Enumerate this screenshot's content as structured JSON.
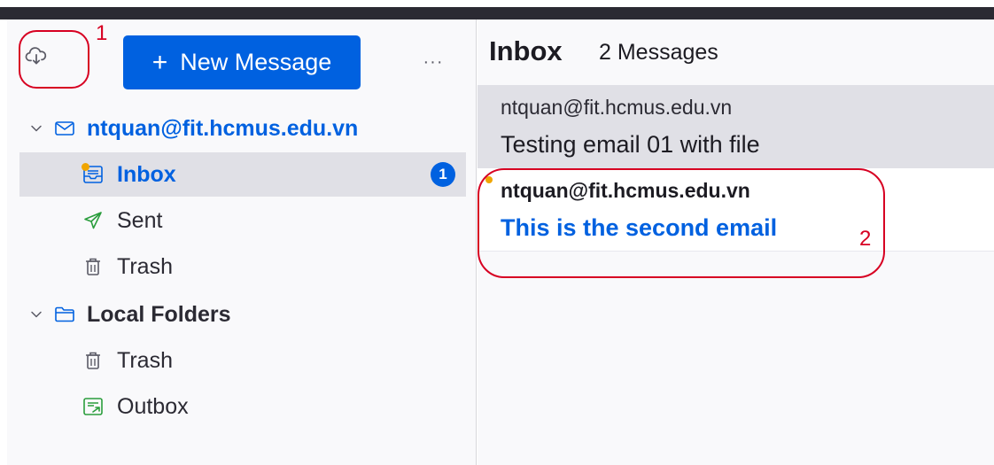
{
  "toolbar": {
    "get_messages_icon": "cloud-download-icon",
    "new_message_label": "New Message",
    "new_message_plus": "+",
    "more_label": "···"
  },
  "folders": {
    "account": {
      "label": "ntquan@fit.hcmus.edu.vn",
      "icon": "envelope-icon"
    },
    "inbox": {
      "label": "Inbox",
      "unread": "1",
      "icon": "inbox-icon"
    },
    "sent": {
      "label": "Sent",
      "icon": "paper-plane-icon"
    },
    "trash": {
      "label": "Trash",
      "icon": "trash-icon"
    },
    "local": {
      "label": "Local Folders",
      "icon": "folder-icon"
    },
    "local_trash": {
      "label": "Trash",
      "icon": "trash-icon"
    },
    "outbox": {
      "label": "Outbox",
      "icon": "outbox-icon"
    }
  },
  "message_list": {
    "title": "Inbox",
    "count": "2 Messages",
    "messages": [
      {
        "from": "ntquan@fit.hcmus.edu.vn",
        "subject": "Testing email 01 with file",
        "unread": false
      },
      {
        "from": "ntquan@fit.hcmus.edu.vn",
        "subject": "This is the second email",
        "unread": true
      }
    ]
  },
  "annotations": {
    "one": "1",
    "two": "2"
  },
  "colors": {
    "accent": "#0061e0",
    "annotation": "#d70022",
    "selected": "#e0e0e6"
  }
}
